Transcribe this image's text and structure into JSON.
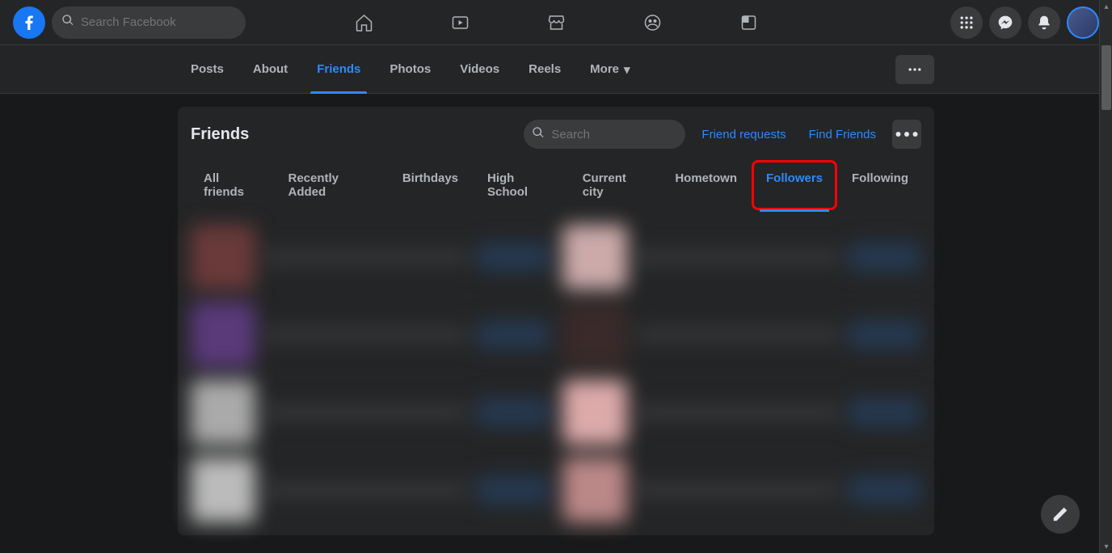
{
  "topbar": {
    "search_placeholder": "Search Facebook"
  },
  "profile_tabs": {
    "items": [
      "Posts",
      "About",
      "Friends",
      "Photos",
      "Videos",
      "Reels",
      "More"
    ],
    "active_index": 2
  },
  "friends_panel": {
    "title": "Friends",
    "search_placeholder": "Search",
    "friend_requests_label": "Friend requests",
    "find_friends_label": "Find Friends"
  },
  "filter_tabs": {
    "items": [
      "All friends",
      "Recently Added",
      "Birthdays",
      "High School",
      "Current city",
      "Hometown",
      "Followers",
      "Following"
    ],
    "active_index": 6,
    "highlighted_index": 6
  }
}
